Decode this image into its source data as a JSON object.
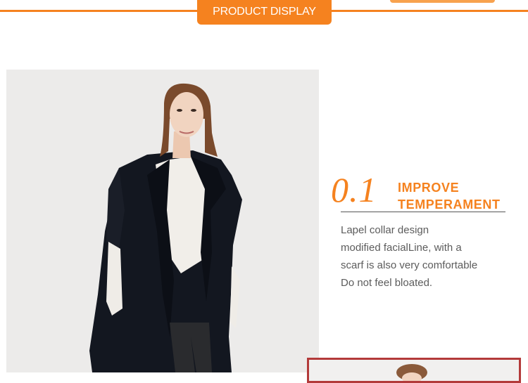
{
  "header": {
    "banner_label": "PRODUCT DISPLAY",
    "accent_color": "#f5821f"
  },
  "feature": {
    "number": "0.1",
    "title": "IMPROVE\nTEMPERAMENT",
    "description": "Lapel collar design\nmodified facialLine, with a\nscarf is also very comfortable\nDo not feel bloated."
  },
  "images": {
    "main_photo": "model-wearing-black-lapel-coat",
    "next_photo": "model-portrait-thumbnail"
  }
}
